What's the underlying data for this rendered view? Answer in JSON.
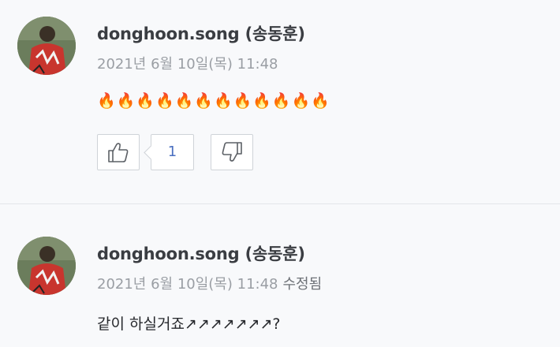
{
  "comments": [
    {
      "author": "donghoon.song (송동훈)",
      "date": "2021년 6월 10일(목) 11:48",
      "edited_label": "",
      "body": "🔥🔥🔥🔥🔥🔥🔥🔥🔥🔥🔥🔥",
      "like_count": "1"
    },
    {
      "author": "donghoon.song (송동훈)",
      "date": "2021년 6월 10일(목) 11:48",
      "edited_label": "수정됨",
      "body": "같이 하실거죠↗↗↗↗↗↗↗?"
    }
  ],
  "icons": {
    "like": "thumbs-up-icon",
    "dislike": "thumbs-down-icon",
    "avatar": "avatar-photo"
  },
  "colors": {
    "background": "#f8f9fb",
    "author_text": "#3a3d42",
    "meta_text": "#9a9ea4",
    "like_count": "#4a6fc0",
    "button_border": "#cfd3d8"
  }
}
